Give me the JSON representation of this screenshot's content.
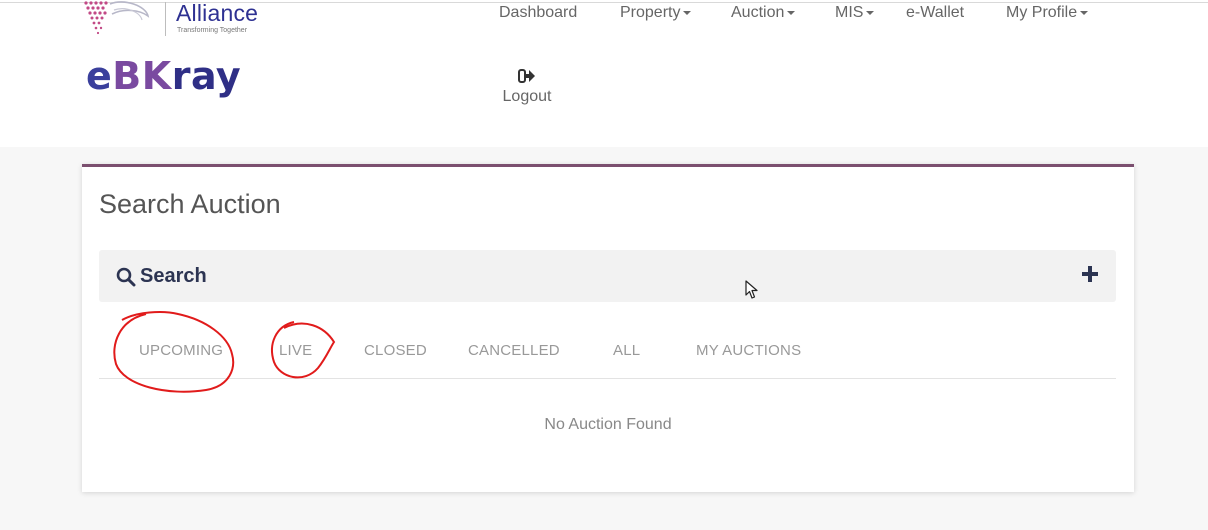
{
  "brand": {
    "partner_name": "Alliance",
    "partner_tagline": "Transforming Together",
    "logo_e": "e",
    "logo_b": "BK",
    "logo_rest": "ray"
  },
  "nav": {
    "items": [
      {
        "label": "Dashboard",
        "dropdown": false
      },
      {
        "label": "Property",
        "dropdown": true
      },
      {
        "label": "Auction",
        "dropdown": true
      },
      {
        "label": "MIS",
        "dropdown": true
      },
      {
        "label": "e-Wallet",
        "dropdown": false
      },
      {
        "label": "My Profile",
        "dropdown": true
      }
    ],
    "logout_label": "Logout"
  },
  "page": {
    "title": "Search Auction"
  },
  "search": {
    "label": "Search"
  },
  "tabs": [
    {
      "label": "UPCOMING",
      "annotated": true
    },
    {
      "label": "LIVE",
      "annotated": true
    },
    {
      "label": "CLOSED",
      "annotated": false
    },
    {
      "label": "CANCELLED",
      "annotated": false
    },
    {
      "label": "ALL",
      "annotated": false
    },
    {
      "label": "MY AUCTIONS",
      "annotated": false
    }
  ],
  "empty_message": "No Auction Found",
  "colors": {
    "accent_border": "#7b4f6f",
    "brand_blue": "#2e3192",
    "annotation_red": "#e11b1b",
    "search_heading": "#2c3452"
  },
  "icons": {
    "logout": "sign-out-icon",
    "search": "magnifier-icon",
    "expand": "plus-icon",
    "cursor": "mouse-pointer-icon"
  }
}
